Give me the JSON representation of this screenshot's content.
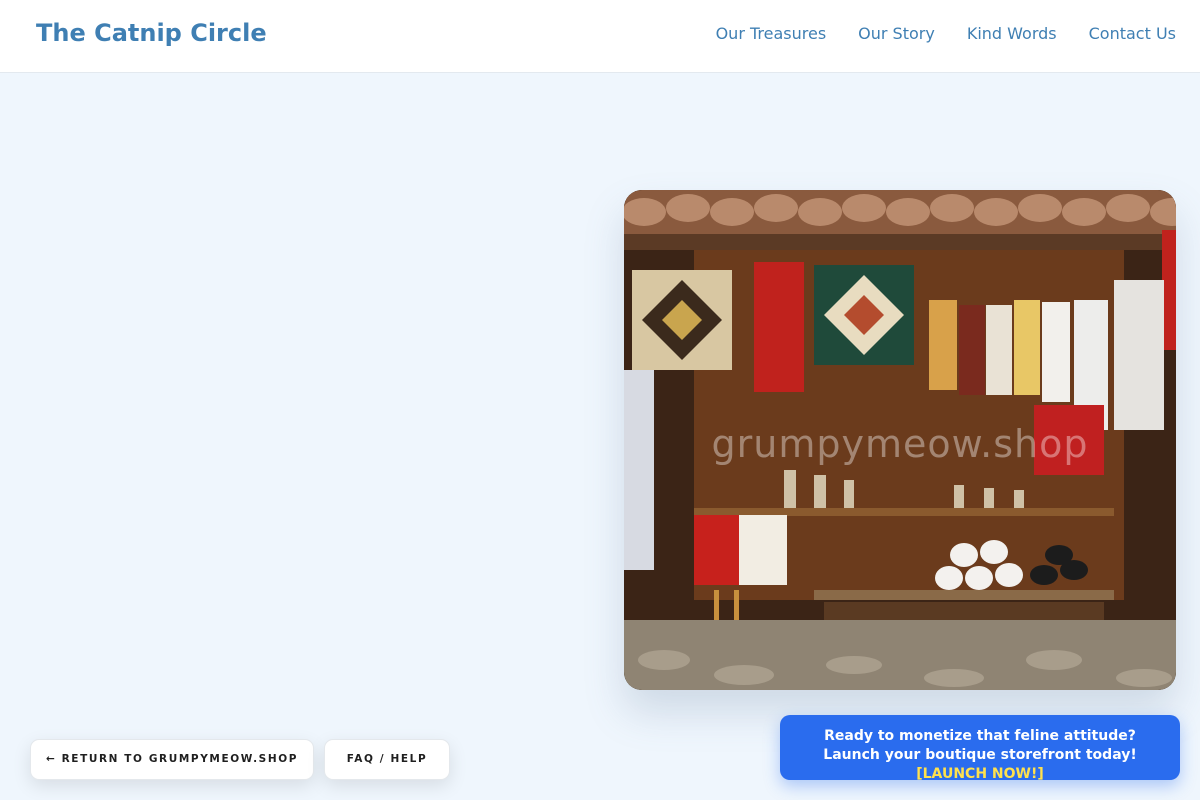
{
  "header": {
    "brand": "The Catnip Circle",
    "nav": [
      "Our Treasures",
      "Our Story",
      "Kind Words",
      "Contact Us"
    ]
  },
  "hero": {
    "watermark": "grumpymeow.shop"
  },
  "footer_buttons": {
    "return_label": "← RETURN TO GRUMPYMEOW.SHOP",
    "faq_label": "FAQ / HELP"
  },
  "cta_banner": {
    "text": "Ready to monetize that feline attitude? Launch your boutique storefront today!",
    "link": "[LAUNCH NOW!]"
  },
  "colors": {
    "page_bg": "#eff6fd",
    "brand": "#3f7fb3",
    "cta_bg": "#2a6cee",
    "cta_link": "#ffe14d"
  }
}
